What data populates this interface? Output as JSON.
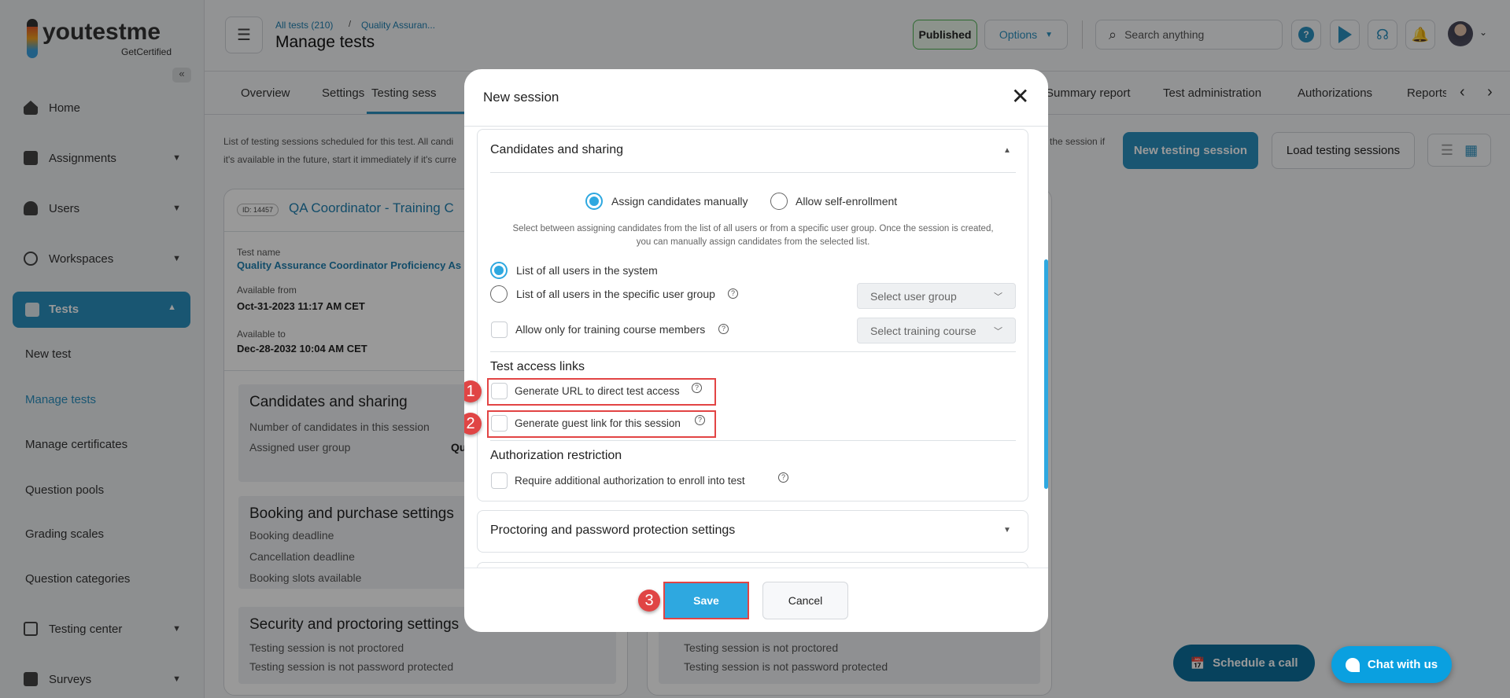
{
  "brand": {
    "name": "youtestme",
    "tagline": "GetCertified"
  },
  "sidebar": {
    "items": [
      {
        "label": "Home",
        "icon": "home-icon"
      },
      {
        "label": "Assignments",
        "icon": "assignments-icon"
      },
      {
        "label": "Users",
        "icon": "users-icon"
      },
      {
        "label": "Workspaces",
        "icon": "globe-icon"
      },
      {
        "label": "Tests",
        "icon": "tests-icon",
        "active": true
      },
      {
        "label": "Testing center",
        "icon": "testing-center-icon"
      },
      {
        "label": "Surveys",
        "icon": "surveys-icon"
      }
    ],
    "sub_items": [
      "New test",
      "Manage tests",
      "Manage certificates",
      "Question pools",
      "Grading scales",
      "Question categories"
    ],
    "active_sub": "Manage tests"
  },
  "header": {
    "breadcrumb": [
      "All tests (210)",
      "Quality Assuran..."
    ],
    "title": "Manage tests",
    "status": "Published",
    "options": "Options",
    "search_placeholder": "Search anything"
  },
  "tabs": [
    "Overview",
    "Settings",
    "Testing sess",
    "Summary report",
    "Test administration",
    "Authorizations",
    "Reports"
  ],
  "active_tab": "Testing sessions",
  "description": {
    "line1": "List of testing sessions scheduled for this test. All candi",
    "line2": "it's available in the future, start it immediately if it's curre",
    "tail": "the session if"
  },
  "actions": {
    "new": "New testing session",
    "load": "Load testing sessions"
  },
  "session_card": {
    "id": "ID: 14457",
    "title": "QA Coordinator - Training C",
    "test_name_label": "Test name",
    "test_name": "Quality Assurance Coordinator Proficiency As",
    "from_label": "Available from",
    "from": "Oct-31-2023 11:17 AM CET",
    "to_label": "Available to",
    "to": "Dec-28-2032 10:04 AM CET",
    "candidates": {
      "title": "Candidates and sharing",
      "rows": [
        "Number of candidates in this session",
        "Assigned user group"
      ],
      "group_value": "Qu"
    },
    "booking": {
      "title": "Booking and purchase settings",
      "rows": [
        "Booking deadline",
        "Cancellation deadline",
        "Booking slots available"
      ]
    },
    "security": {
      "title": "Security and proctoring settings",
      "rows": [
        "Testing session is not proctored",
        "Testing session is not password protected"
      ]
    }
  },
  "second_card": {
    "rows": [
      "Testing session is not proctored",
      "Testing session is not password protected"
    ]
  },
  "modal": {
    "title": "New session",
    "candidates_panel": {
      "title": "Candidates and sharing",
      "mode_options": [
        "Assign candidates manually",
        "Allow self-enrollment"
      ],
      "mode_selected": "Assign candidates manually",
      "help": "Select between assigning candidates from the list of all users or from a specific user group. Once the session is created, you can manually assign candidates from the selected list.",
      "list_options": [
        "List of all users in the system",
        "List of all users in the specific user group"
      ],
      "list_selected": "List of all users in the system",
      "user_group_placeholder": "Select user group",
      "training_label": "Allow only for training course members",
      "training_checked": false,
      "training_placeholder": "Select training course",
      "access_title": "Test access links",
      "direct_url": "Generate URL to direct test access",
      "direct_url_checked": false,
      "guest_link": "Generate guest link for this session",
      "guest_link_checked": false,
      "auth_title": "Authorization restriction",
      "auth_label": "Require additional authorization to enroll into test",
      "auth_checked": false
    },
    "proctoring_panel": "Proctoring and password protection settings",
    "save": "Save",
    "cancel": "Cancel",
    "steps": [
      "1",
      "2",
      "3"
    ]
  },
  "floating": {
    "schedule": "Schedule a call",
    "chat": "Chat with us"
  },
  "colors": {
    "accent": "#2ea8e0",
    "active_nav": "#2a8fbf",
    "annotation": "#e24444",
    "published_border": "#4caf50"
  }
}
